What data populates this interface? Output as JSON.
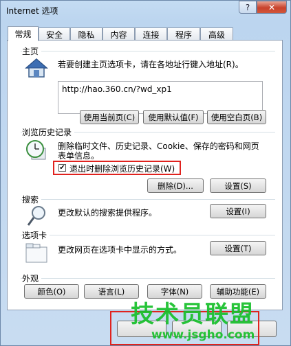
{
  "window": {
    "title": "Internet 选项",
    "help": "?",
    "close": "✕"
  },
  "tabs": [
    "常规",
    "安全",
    "隐私",
    "内容",
    "连接",
    "程序",
    "高级"
  ],
  "home": {
    "section": "主页",
    "desc": "若要创建主页选项卡，请在各地址行键入地址(R)。",
    "url": "http://hao.360.cn/?wd_xp1",
    "btn_current": "使用当前页(C)",
    "btn_default": "使用默认值(F)",
    "btn_blank": "使用空白页(B)"
  },
  "history": {
    "section": "浏览历史记录",
    "desc_line1": "删除临时文件、历史记录、Cookie、保存的密码和网页",
    "desc_line2": "表单信息。",
    "checkbox_label": "退出时删除浏览历史记录(W)",
    "checkbox_checked": true,
    "btn_delete": "删除(D)...",
    "btn_settings": "设置(S)"
  },
  "search": {
    "section": "搜索",
    "desc": "更改默认的搜索提供程序。",
    "btn_settings": "设置(I)"
  },
  "tabs_section": {
    "section": "选项卡",
    "desc": "更改网页在选项卡中显示的方式。",
    "btn_settings": "设置(T)"
  },
  "appearance": {
    "section": "外观",
    "btn_colors": "颜色(O)",
    "btn_languages": "语言(L)",
    "btn_fonts": "字体(N)",
    "btn_accessibility": "辅助功能(E)"
  },
  "watermark": {
    "line1": "技术员联盟",
    "line2": "www.jsgho.com"
  },
  "colors": {
    "accent_red": "#e0221e",
    "watermark_green": "#18c02c"
  }
}
